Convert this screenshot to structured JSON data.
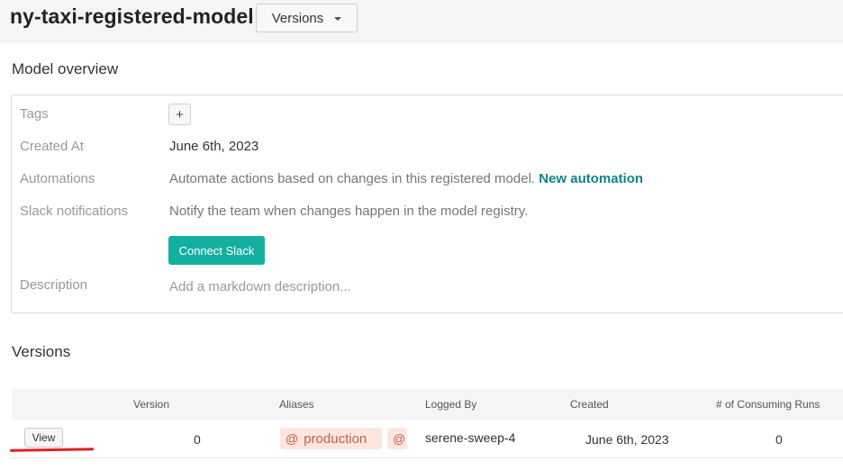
{
  "header": {
    "model_name": "ny-taxi-registered-model",
    "versions_dropdown": "Versions"
  },
  "overview": {
    "title": "Model overview",
    "tags_label": "Tags",
    "tags_add": "+",
    "created_label": "Created At",
    "created_value": "June 6th, 2023",
    "automations_label": "Automations",
    "automations_text": "Automate actions based on changes in this registered model.",
    "automations_link": "New automation",
    "slack_label": "Slack notifications",
    "slack_text": "Notify the team when changes happen in the model registry.",
    "slack_button": "Connect Slack",
    "description_label": "Description",
    "description_placeholder": "Add a markdown description..."
  },
  "versions": {
    "title": "Versions",
    "columns": [
      "Version",
      "Aliases",
      "Logged By",
      "Created",
      "# of Consuming Runs"
    ],
    "rows": [
      {
        "action": "View",
        "version": "0",
        "aliases": [
          "production",
          ""
        ],
        "logged_by": "serene-sweep-4",
        "created": "June 6th, 2023",
        "consuming_runs": "0"
      }
    ]
  },
  "colors": {
    "accent_teal": "#13b0a0",
    "link_teal": "#13828e",
    "alias_bg": "#fde6df",
    "annotation_red": "#e02020"
  }
}
